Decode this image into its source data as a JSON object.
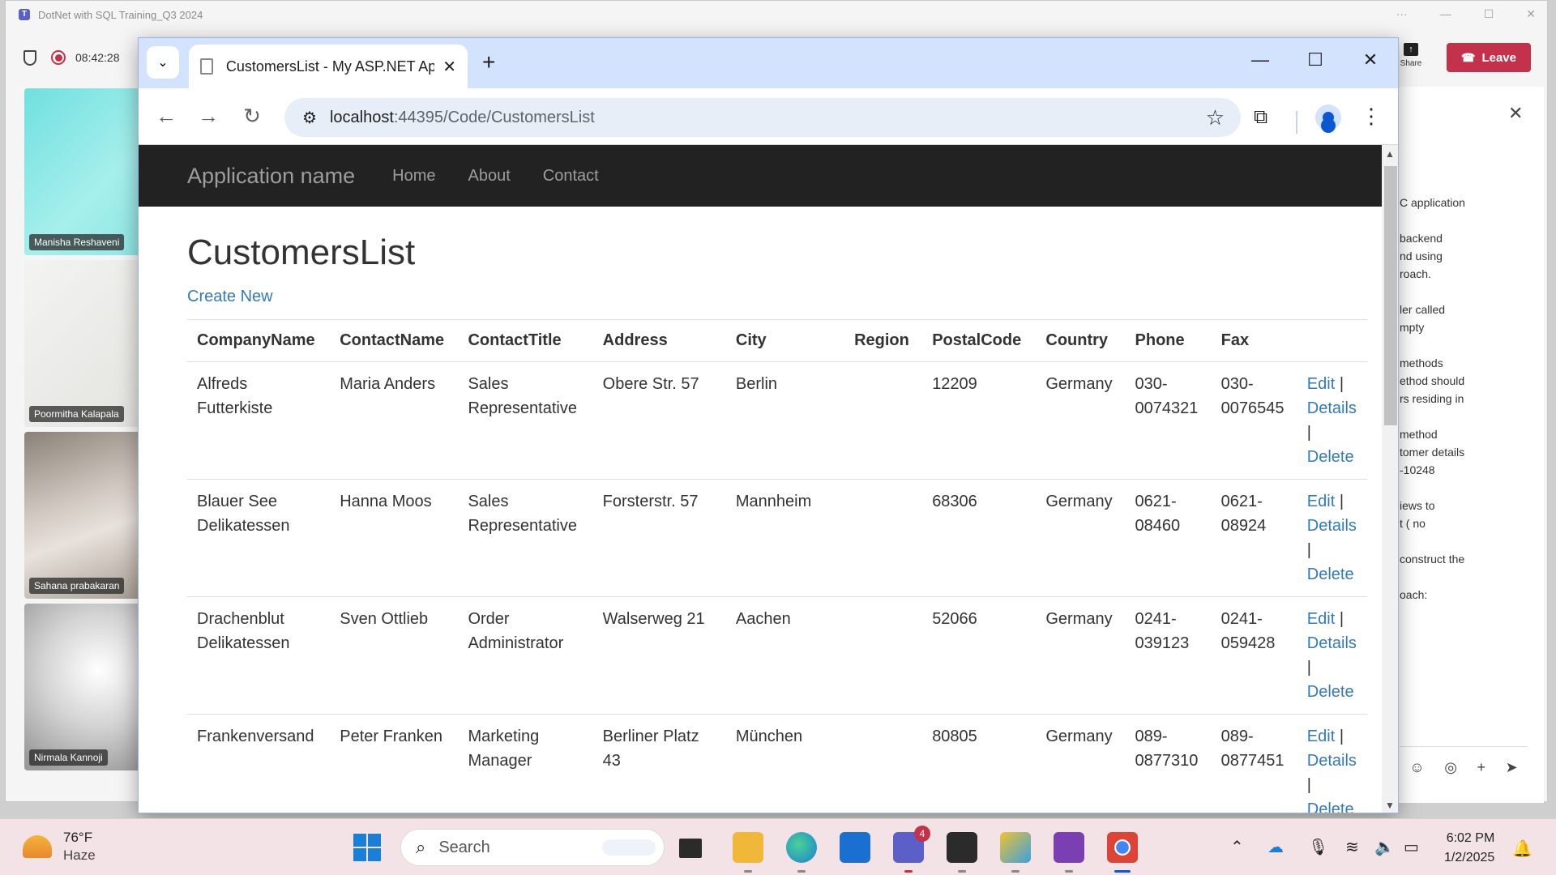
{
  "teams": {
    "window_title": "DotNet with SQL Training_Q3 2024",
    "timer": "08:42:28",
    "share_label": "Share",
    "leave_label": "Leave",
    "participants": [
      {
        "name": "Manisha Reshaveni"
      },
      {
        "name": "Poormitha Kalapala"
      },
      {
        "name": "Sahana prabakaran"
      },
      {
        "name": "Nirmala Kannoji"
      }
    ],
    "chat_snippets": [
      "C application",
      "backend\nnd using\nroach.",
      "ler called\nmpty",
      "methods\nethod should\nrs residing in",
      "method\ntomer details\n-10248",
      "iews to\nt ( no",
      "construct the",
      "oach:"
    ]
  },
  "browser": {
    "tab_title": "CustomersList - My ASP.NET Ap",
    "url_host": "localhost",
    "url_path": ":44395/Code/CustomersList"
  },
  "site": {
    "brand": "Application name",
    "nav": [
      "Home",
      "About",
      "Contact"
    ],
    "page_title": "CustomersList",
    "create_new": "Create New",
    "columns": [
      "CompanyName",
      "ContactName",
      "ContactTitle",
      "Address",
      "City",
      "Region",
      "PostalCode",
      "Country",
      "Phone",
      "Fax"
    ],
    "actions": {
      "edit": "Edit",
      "details": "Details",
      "delete": "Delete",
      "sep": "|"
    },
    "rows": [
      {
        "company": "Alfreds Futterkiste",
        "contact": "Maria Anders",
        "title": "Sales Representative",
        "address": "Obere Str. 57",
        "city": "Berlin",
        "region": "",
        "postal": "12209",
        "country": "Germany",
        "phone": "030-0074321",
        "fax": "030-0076545"
      },
      {
        "company": "Blauer See Delikatessen",
        "contact": "Hanna Moos",
        "title": "Sales Representative",
        "address": "Forsterstr. 57",
        "city": "Mannheim",
        "region": "",
        "postal": "68306",
        "country": "Germany",
        "phone": "0621-08460",
        "fax": "0621-08924"
      },
      {
        "company": "Drachenblut Delikatessen",
        "contact": "Sven Ottlieb",
        "title": "Order Administrator",
        "address": "Walserweg 21",
        "city": "Aachen",
        "region": "",
        "postal": "52066",
        "country": "Germany",
        "phone": "0241-039123",
        "fax": "0241-059428"
      },
      {
        "company": "Frankenversand",
        "contact": "Peter Franken",
        "title": "Marketing Manager",
        "address": "Berliner Platz 43",
        "city": "München",
        "region": "",
        "postal": "80805",
        "country": "Germany",
        "phone": "089-0877310",
        "fax": "089-0877451"
      }
    ]
  },
  "taskbar": {
    "temperature": "76°F",
    "condition": "Haze",
    "search_placeholder": "Search",
    "teams_badge": "4",
    "time": "6:02 PM",
    "date": "1/2/2025"
  },
  "colors": {
    "link": "#337ab7",
    "navbar": "#222222",
    "leave": "#c4314b",
    "chrome_tabstrip": "#d3e3fd"
  }
}
